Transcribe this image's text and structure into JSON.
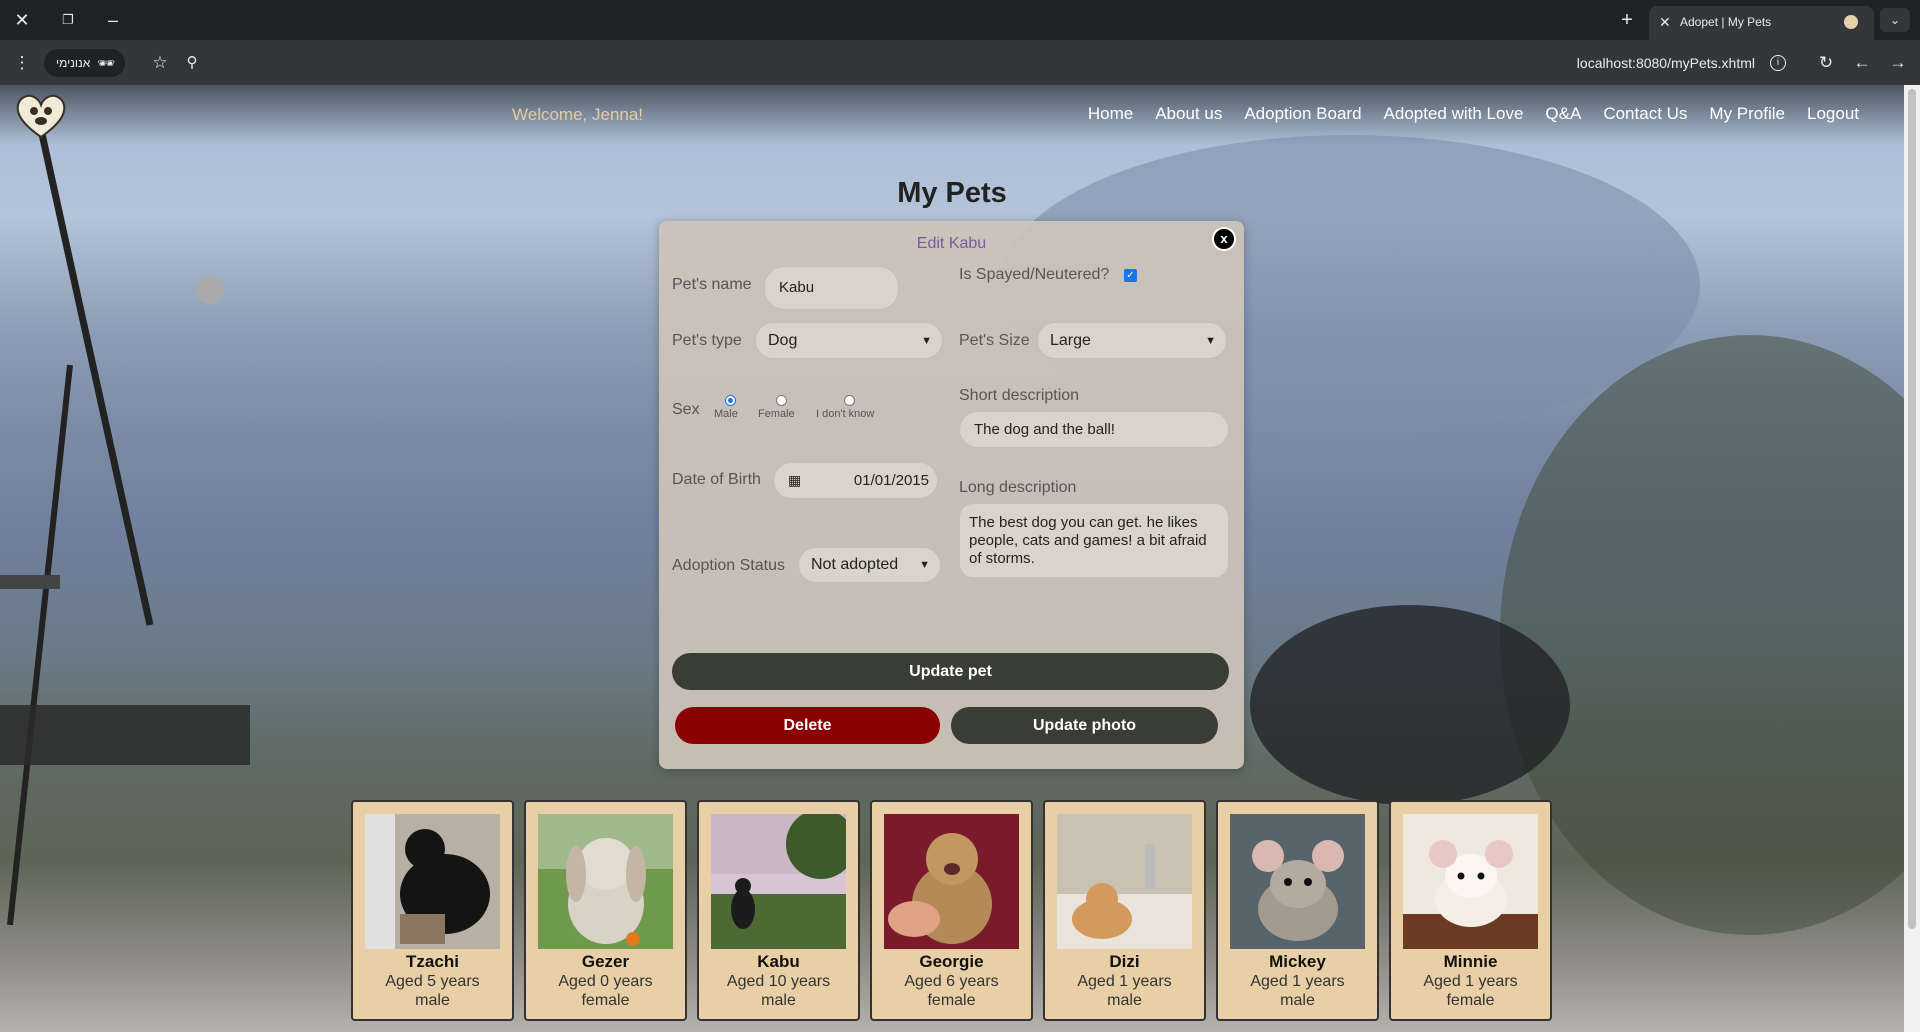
{
  "browser": {
    "tab_title": "Adopet | My Pets",
    "incognito_label": "אנונימי",
    "url": "localhost:8080/myPets.xhtml"
  },
  "nav": {
    "welcome": "Welcome, Jenna!",
    "links": [
      "Home",
      "About us",
      "Adoption Board",
      "Adopted with Love",
      "Q&A",
      "Contact Us",
      "My Profile",
      "Logout"
    ]
  },
  "page": {
    "title": "My Pets"
  },
  "modal": {
    "title": "Edit Kabu",
    "close_label": "x",
    "pet_name_label": "Pet's name",
    "pet_name_value": "Kabu",
    "spayed_label": "Is Spayed/Neutered?",
    "spayed_checked": true,
    "pet_type_label": "Pet's type",
    "pet_type_value": "Dog",
    "pet_size_label": "Pet's Size",
    "pet_size_value": "Large",
    "short_desc_label": "Short description",
    "short_desc_value": "The dog and the ball!",
    "sex_label": "Sex",
    "sex_options": [
      "Male",
      "Female",
      "I don't know"
    ],
    "sex_selected": "Male",
    "long_desc_label": "Long description",
    "long_desc_value": "The best dog you can get. he likes people, cats and games! a bit afraid of storms.",
    "dob_label": "Date of Birth",
    "dob_value": "01/01/2015",
    "adoption_status_label": "Adoption Status",
    "adoption_status_value": "Not adopted",
    "update_pet_label": "Update pet",
    "delete_label": "Delete",
    "update_photo_label": "Update photo"
  },
  "pets": [
    {
      "name": "Tzachi",
      "age": "Aged 5 years",
      "sex": "male"
    },
    {
      "name": "Gezer",
      "age": "Aged 0 years",
      "sex": "female"
    },
    {
      "name": "Kabu",
      "age": "Aged 10 years",
      "sex": "male"
    },
    {
      "name": "Georgie",
      "age": "Aged 6 years",
      "sex": "female"
    },
    {
      "name": "Dizi",
      "age": "Aged 1 years",
      "sex": "male"
    },
    {
      "name": "Mickey",
      "age": "Aged 1 years",
      "sex": "male"
    },
    {
      "name": "Minnie",
      "age": "Aged 1 years",
      "sex": "female"
    }
  ],
  "colors": {
    "welcome": "#e6cb9c",
    "modal_title": "#7a5a9c",
    "card_bg": "#e8cfa6",
    "dark_button": "#3a3c36",
    "delete_button": "#8b0000"
  }
}
